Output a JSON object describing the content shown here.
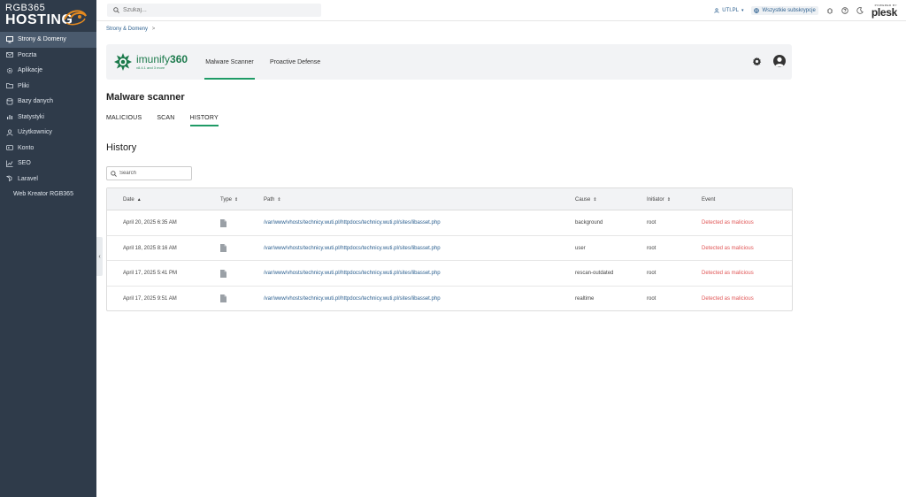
{
  "sidebar": {
    "logo_top": "RGB365",
    "logo_bottom": "HOSTING",
    "items": [
      {
        "label": "Strony & Domeny",
        "icon": "monitor-icon",
        "active": true
      },
      {
        "label": "Poczta",
        "icon": "mail-icon"
      },
      {
        "label": "Aplikacje",
        "icon": "gear-icon"
      },
      {
        "label": "Pliki",
        "icon": "folder-icon"
      },
      {
        "label": "Bazy danych",
        "icon": "database-icon"
      },
      {
        "label": "Statystyki",
        "icon": "bar-chart-icon"
      },
      {
        "label": "Użytkownicy",
        "icon": "user-icon"
      },
      {
        "label": "Konto",
        "icon": "account-icon"
      },
      {
        "label": "SEO",
        "icon": "chart-line-icon"
      },
      {
        "label": "Laravel",
        "icon": "laravel-icon"
      },
      {
        "label": "Web Kreator RGB365",
        "icon": "none"
      }
    ]
  },
  "topbar": {
    "search_placeholder": "Szukaj...",
    "user": "UTI.PL",
    "subscriptions": "Wszystkie subskrypcje",
    "powered_by": "POWERED BY",
    "plesk": "plesk"
  },
  "breadcrumb": {
    "item": "Strony & Domeny",
    "sep": ">"
  },
  "imunify": {
    "brand_prefix": "imunify",
    "brand_suffix": "360",
    "version": "v8.4.1 and 3 more",
    "tabs": [
      {
        "label": "Malware Scanner",
        "active": true
      },
      {
        "label": "Proactive Defense",
        "active": false
      }
    ]
  },
  "scanner": {
    "title": "Malware scanner",
    "subtabs": [
      {
        "label": "MALICIOUS",
        "active": false
      },
      {
        "label": "SCAN",
        "active": false
      },
      {
        "label": "HISTORY",
        "active": true
      }
    ],
    "history_title": "History",
    "search_placeholder": "Search"
  },
  "table": {
    "columns": {
      "date": "Date",
      "type": "Type",
      "path": "Path",
      "cause": "Cause",
      "initiator": "Initiator",
      "event": "Event"
    },
    "rows": [
      {
        "date": "April 20, 2025 6:35 AM",
        "path": "/var/www/vhosts/technicy.wuti.pl/httpdocs/technicy.wuti.pl/sites/libasset.php",
        "cause": "background",
        "initiator": "root",
        "event": "Detected as malicious"
      },
      {
        "date": "April 18, 2025 8:16 AM",
        "path": "/var/www/vhosts/technicy.wuti.pl/httpdocs/technicy.wuti.pl/sites/libasset.php",
        "cause": "user",
        "initiator": "root",
        "event": "Detected as malicious"
      },
      {
        "date": "April 17, 2025 5:41 PM",
        "path": "/var/www/vhosts/technicy.wuti.pl/httpdocs/technicy.wuti.pl/sites/libasset.php",
        "cause": "rescan-outdated",
        "initiator": "root",
        "event": "Detected as malicious"
      },
      {
        "date": "April 17, 2025 9:51 AM",
        "path": "/var/www/vhosts/technicy.wuti.pl/httpdocs/technicy.wuti.pl/sites/libasset.php",
        "cause": "realtime",
        "initiator": "root",
        "event": "Detected as malicious"
      }
    ]
  },
  "colors": {
    "sidebar_bg": "#2f3b4a",
    "accent_green": "#1f9b66",
    "link_blue": "#2b5f8f",
    "event_red": "#e05555"
  }
}
